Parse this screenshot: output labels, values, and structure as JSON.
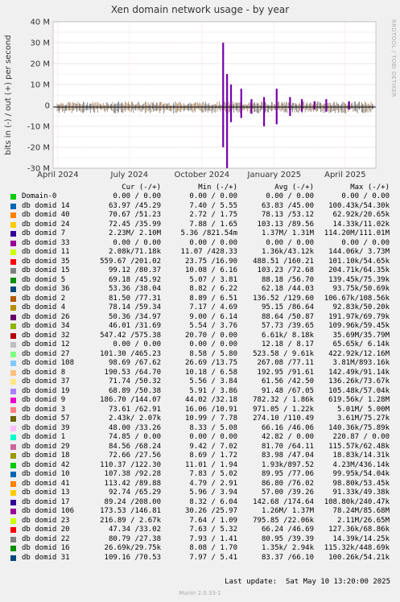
{
  "title": "Xen domain network usage - by year",
  "side_label": "RRDTOOL / TOBI OETIKER",
  "legend_header": {
    "cur": "Cur (-/+)",
    "min": "Min (-/+)",
    "avg": "Avg (-/+)",
    "max": "Max (-/+)"
  },
  "legend": [
    {
      "name": "Domain-0",
      "color": "#00cc00",
      "cur": "0.00 / 0.00",
      "min": "0.00 / 0.00",
      "avg": "0.00 / 0.00",
      "max": "0.00 / 0.00"
    },
    {
      "name": "db domid 14",
      "color": "#0066b3",
      "cur": "63.97 /45.29",
      "min": "7.40 / 5.55",
      "avg": "63.83 /45.00",
      "max": "100.43k/54.30k"
    },
    {
      "name": "db domid 40",
      "color": "#ff8000",
      "cur": "70.67 /51.23",
      "min": "2.72 / 1.75",
      "avg": "78.13 /53.12",
      "max": "62.92k/20.65k"
    },
    {
      "name": "db domid 24",
      "color": "#ffcc00",
      "cur": "72.45 /35.99",
      "min": "7.88 / 1.65",
      "avg": "103.13 /89.56",
      "max": "14.33k/11.02k"
    },
    {
      "name": "db domid 7",
      "color": "#330099",
      "cur": "2.23M/ 2.10M",
      "min": "5.36 /821.54m",
      "avg": "1.37M/ 1.31M",
      "max": "114.20M/111.01M"
    },
    {
      "name": "db domid 33",
      "color": "#990099",
      "cur": "0.00 / 0.00",
      "min": "0.00 / 0.00",
      "avg": "0.00 / 0.00",
      "max": "0.00 / 0.00"
    },
    {
      "name": "db domid 11",
      "color": "#ccff00",
      "cur": "2.08k/71.18k",
      "min": "11.07 /428.33",
      "avg": "1.36k/43.12k",
      "max": "144.06k/ 3.73M"
    },
    {
      "name": "db domid 35",
      "color": "#ff0000",
      "cur": "559.67 /201.02",
      "min": "23.75 /16.90",
      "avg": "488.51 /160.21",
      "max": "101.10k/54.65k"
    },
    {
      "name": "db domid 15",
      "color": "#808080",
      "cur": "99.12 /80.37",
      "min": "10.08 / 6.16",
      "avg": "103.23 /72.68",
      "max": "204.71k/64.35k"
    },
    {
      "name": "db domid 5",
      "color": "#008f00",
      "cur": "69.18 /45.92",
      "min": "5.07 / 3.81",
      "avg": "88.18 /56.70",
      "max": "139.45k/75.39k"
    },
    {
      "name": "db domid 36",
      "color": "#00487d",
      "cur": "53.36 /38.04",
      "min": "8.82 / 6.22",
      "avg": "62.18 /44.03",
      "max": "93.75k/50.69k"
    },
    {
      "name": "db domid 2",
      "color": "#b35a00",
      "cur": "81.50 /77.31",
      "min": "8.89 / 6.51",
      "avg": "136.52 /129.60",
      "max": "106.67k/108.56k"
    },
    {
      "name": "db domid 4",
      "color": "#b38f00",
      "cur": "78.14 /59.34",
      "min": "7.17 / 4.69",
      "avg": "95.15 /86.64",
      "max": "92.83k/50.20k"
    },
    {
      "name": "db domid 26",
      "color": "#6b006b",
      "cur": "50.36 /34.97",
      "min": "9.00 / 6.14",
      "avg": "88.64 /50.87",
      "max": "191.97k/69.79k"
    },
    {
      "name": "db domid 34",
      "color": "#8fb300",
      "cur": "46.01 /31.69",
      "min": "5.54 / 3.76",
      "avg": "57.73 /39.65",
      "max": "109.96k/59.45k"
    },
    {
      "name": "db domid 32",
      "color": "#b30000",
      "cur": "547.42 /575.38",
      "min": "20.70 / 0.00",
      "avg": "6.61k/ 8.18k",
      "max": "35.69M/35.79M"
    },
    {
      "name": "db domid 12",
      "color": "#bebebe",
      "cur": "0.00 / 0.00",
      "min": "0.00 / 0.00",
      "avg": "12.18 / 8.17",
      "max": "65.65k/ 6.14k"
    },
    {
      "name": "db domid 27",
      "color": "#80ff80",
      "cur": "101.30 /465.23",
      "min": "8.58 / 5.80",
      "avg": "523.58 / 9.61k",
      "max": "422.92k/12.16M"
    },
    {
      "name": "db domid 108",
      "color": "#80c9ff",
      "cur": "98.69 /67.62",
      "min": "26.69 /13.75",
      "avg": "267.08 /77.11",
      "max": "3.81M/893.16k"
    },
    {
      "name": "db domid 8",
      "color": "#ffc080",
      "cur": "190.53 /64.70",
      "min": "10.18 / 6.58",
      "avg": "192.95 /91.61",
      "max": "142.49k/91.14k"
    },
    {
      "name": "db domid 37",
      "color": "#ffe680",
      "cur": "71.74 /50.32",
      "min": "5.56 / 3.84",
      "avg": "61.56 /42.50",
      "max": "136.26k/73.67k"
    },
    {
      "name": "db domid 19",
      "color": "#aa80ff",
      "cur": "68.89 /50.38",
      "min": "5.91 / 3.86",
      "avg": "91.48 /67.05",
      "max": "105.48k/57.04k"
    },
    {
      "name": "db domid 9",
      "color": "#ee00cc",
      "cur": "186.70 /144.07",
      "min": "44.02 /32.18",
      "avg": "782.32 / 1.86k",
      "max": "619.56k/ 1.28M"
    },
    {
      "name": "db domid 3",
      "color": "#ff8080",
      "cur": "73.61 /62.91",
      "min": "16.06 /10.91",
      "avg": "971.05 / 1.22k",
      "max": "5.01M/ 5.00M"
    },
    {
      "name": "db domid 57",
      "color": "#666600",
      "cur": "2.43k/ 2.07k",
      "min": "10.99 / 7.78",
      "avg": "274.10 /110.49",
      "max": "3.61M/75.27k"
    },
    {
      "name": "db domid 39",
      "color": "#ffbfff",
      "cur": "48.00 /33.26",
      "min": "8.33 / 5.08",
      "avg": "66.16 /46.06",
      "max": "140.36k/75.89k"
    },
    {
      "name": "db domid 1",
      "color": "#00ffcc",
      "cur": "74.85 / 0.00",
      "min": "0.00 / 0.00",
      "avg": "42.82 / 0.00",
      "max": "220.87 / 0.00"
    },
    {
      "name": "db domid 29",
      "color": "#cc6699",
      "cur": "84.56 /68.24",
      "min": "9.42 / 7.02",
      "avg": "81.70 /64.11",
      "max": "115.57k/62.48k"
    },
    {
      "name": "db domid 18",
      "color": "#999900",
      "cur": "72.66 /27.56",
      "min": "8.69 / 1.72",
      "avg": "83.98 /47.04",
      "max": "18.83k/14.31k"
    },
    {
      "name": "db domid 42",
      "color": "#00cc00",
      "cur": "110.37 /122.30",
      "min": "11.01 / 1.94",
      "avg": "1.93k/897.52",
      "max": "4.23M/436.14k"
    },
    {
      "name": "db domid 10",
      "color": "#0066b3",
      "cur": "107.38 /92.28",
      "min": "7.83 / 5.02",
      "avg": "89.95 /77.06",
      "max": "99.95k/54.04k"
    },
    {
      "name": "db domid 41",
      "color": "#ff8000",
      "cur": "113.42 /89.88",
      "min": "4.79 / 2.91",
      "avg": "86.80 /76.02",
      "max": "98.80k/53.45k"
    },
    {
      "name": "db domid 13",
      "color": "#ffcc00",
      "cur": "92.74 /65.29",
      "min": "5.96 / 3.94",
      "avg": "57.00 /39.26",
      "max": "91.33k/49.38k"
    },
    {
      "name": "db domid 17",
      "color": "#330099",
      "cur": "89.24 /208.00",
      "min": "8.32 / 6.04",
      "avg": "142.68 /174.64",
      "max": "108.80k/240.47k"
    },
    {
      "name": "db domid 106",
      "color": "#990099",
      "cur": "173.53 /146.81",
      "min": "30.26 /25.97",
      "avg": "1.26M/ 1.37M",
      "max": "78.24M/85.68M"
    },
    {
      "name": "db domid 23",
      "color": "#ccff00",
      "cur": "216.89 / 2.67k",
      "min": "7.64 / 1.09",
      "avg": "795.85 /22.06k",
      "max": "2.11M/26.65M"
    },
    {
      "name": "db domid 20",
      "color": "#ff0000",
      "cur": "47.34 /33.02",
      "min": "7.63 / 5.32",
      "avg": "66.24 /46.69",
      "max": "127.36k/68.86k"
    },
    {
      "name": "db domid 22",
      "color": "#808080",
      "cur": "80.79 /27.38",
      "min": "7.93 / 1.41",
      "avg": "80.95 /39.39",
      "max": "14.39k/14.25k"
    },
    {
      "name": "db domid 16",
      "color": "#008f00",
      "cur": "26.69k/29.75k",
      "min": "8.08 / 1.70",
      "avg": "1.35k/ 2.94k",
      "max": "115.32k/448.69k"
    },
    {
      "name": "db domid 31",
      "color": "#00487d",
      "cur": "109.16 /70.53",
      "min": "7.97 / 5.41",
      "avg": "83.37 /66.10",
      "max": "100.26k/54.21k"
    }
  ],
  "last_update": "Last update:  Sat May 10 13:20:00 2025",
  "munin_version": "Munin 2.0.33-1",
  "chart_data": {
    "type": "area",
    "title": "Xen domain network usage - by year",
    "ylabel": "bits in (-) / out (+) per second",
    "ylim": [
      -30000000,
      40000000
    ],
    "yticks": [
      {
        "value": 40000000,
        "label": "40 M"
      },
      {
        "value": 30000000,
        "label": "30 M"
      },
      {
        "value": 20000000,
        "label": "20 M"
      },
      {
        "value": 10000000,
        "label": "10 M"
      },
      {
        "value": 0,
        "label": "0"
      },
      {
        "value": -10000000,
        "label": "-10 M"
      },
      {
        "value": -20000000,
        "label": "-20 M"
      },
      {
        "value": -30000000,
        "label": "-30 M"
      }
    ],
    "xlim": [
      "2024-03-26",
      "2025-05-10"
    ],
    "xticks": [
      {
        "date": "2024-04-01",
        "label": "April 2024"
      },
      {
        "date": "2024-07-01",
        "label": "July 2024"
      },
      {
        "date": "2024-10-01",
        "label": "October 2024"
      },
      {
        "date": "2025-01-01",
        "label": "January 2025"
      },
      {
        "date": "2025-04-01",
        "label": "April 2025"
      }
    ],
    "grid": true,
    "series_color": "#7700aa",
    "series": [
      {
        "x": "2024-10-28",
        "out": 30000000,
        "in": -20000000
      },
      {
        "x": "2024-11-02",
        "out": 15000000,
        "in": -30000000
      },
      {
        "x": "2024-11-07",
        "out": 10000000,
        "in": -8000000
      },
      {
        "x": "2024-11-20",
        "out": 8000000,
        "in": -6000000
      },
      {
        "x": "2024-12-03",
        "out": 3000000,
        "in": -4000000
      },
      {
        "x": "2024-12-19",
        "out": 4000000,
        "in": -10000000
      },
      {
        "x": "2025-01-04",
        "out": 8000000,
        "in": -9000000
      },
      {
        "x": "2025-01-21",
        "out": 4000000,
        "in": -5000000
      },
      {
        "x": "2025-02-05",
        "out": 3000000,
        "in": -3000000
      },
      {
        "x": "2025-02-21",
        "out": 2000000,
        "in": -2000000
      },
      {
        "x": "2025-03-08",
        "out": 3000000,
        "in": -3000000
      },
      {
        "x": "2025-04-06",
        "out": 2000000,
        "in": -2000000
      }
    ]
  }
}
